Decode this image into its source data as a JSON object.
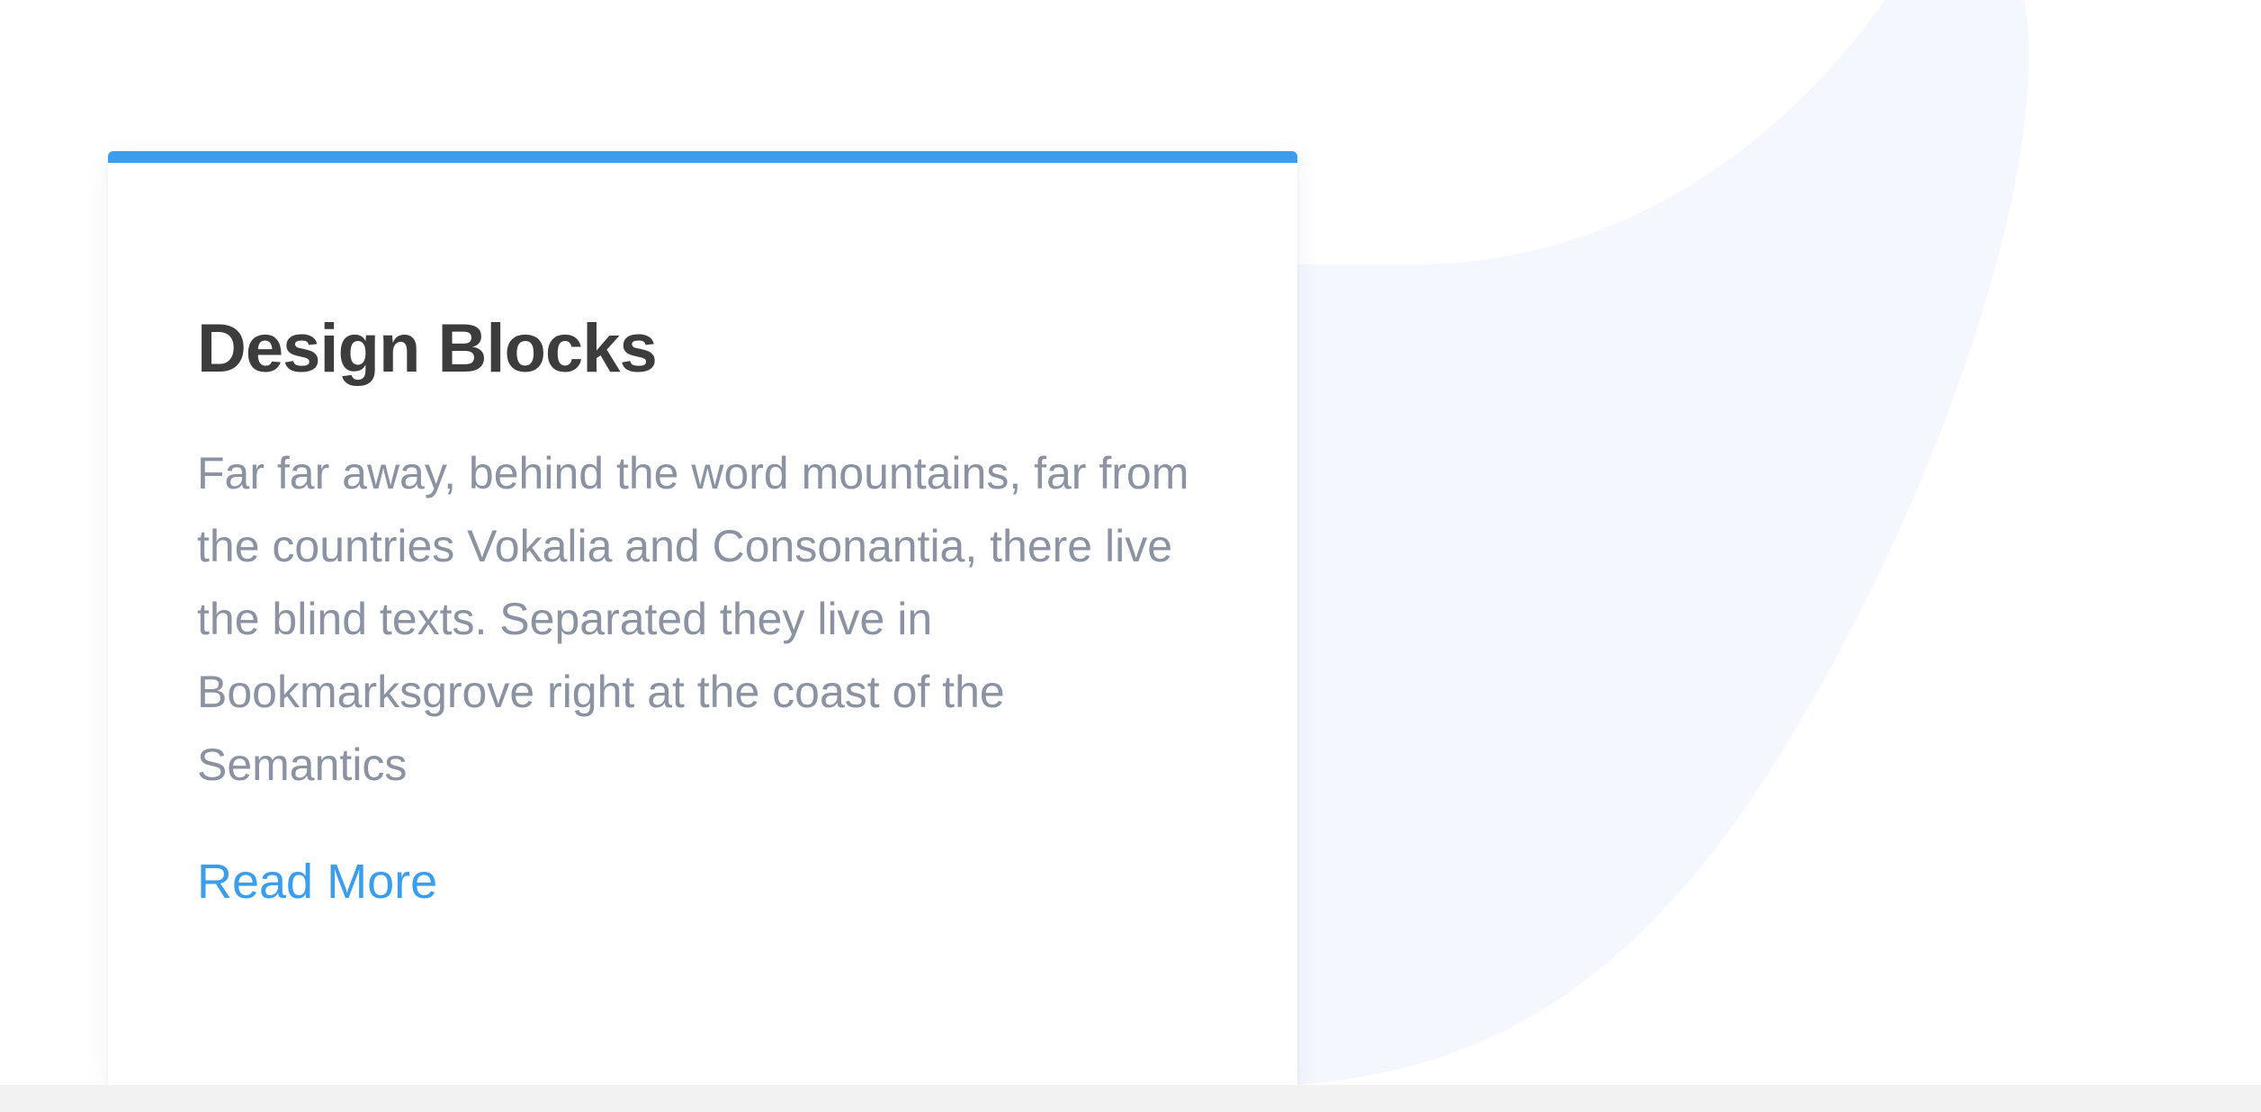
{
  "card": {
    "title": "Design Blocks",
    "body": "Far far away, behind the word mountains, far from the countries Vokalia and Consonantia, there live the blind texts. Separated they live in Bookmarksgrove right at the coast of the Semantics",
    "read_more_label": "Read More"
  },
  "colors": {
    "accent": "#3a9ded",
    "title": "#3c3c3c",
    "body_text": "#8b93a2",
    "background_shape": "#f4f7fd",
    "footer_strip": "#f2f2f2"
  }
}
